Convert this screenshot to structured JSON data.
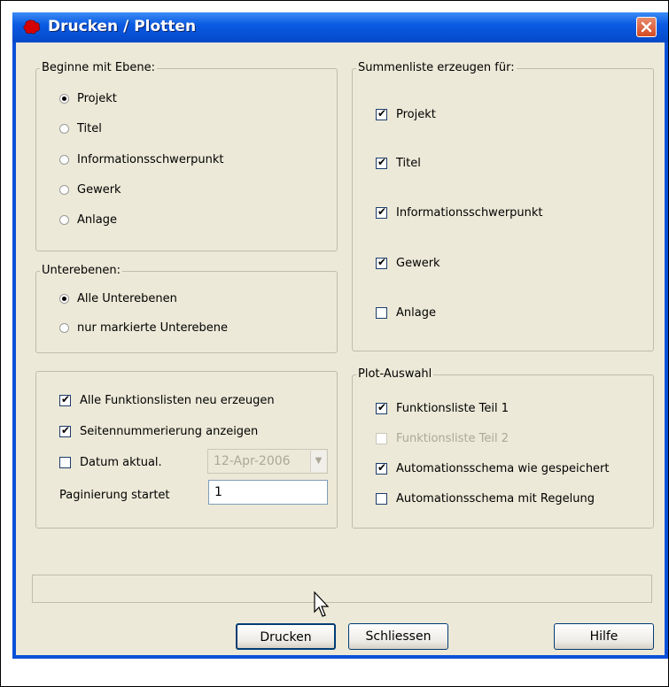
{
  "window": {
    "title": "Drucken / Plotten"
  },
  "ebene": {
    "label": "Beginne mit Ebene:",
    "options": [
      "Projekt",
      "Titel",
      "Informationsschwerpunkt",
      "Gewerk",
      "Anlage"
    ],
    "selected": "Projekt"
  },
  "unterebenen": {
    "label": "Unterebenen:",
    "options": [
      "Alle Unterebenen",
      "nur markierte Unterebene"
    ],
    "selected": "Alle Unterebenen"
  },
  "summenliste": {
    "label": "Summenliste erzeugen für:",
    "items": [
      {
        "label": "Projekt",
        "checked": true
      },
      {
        "label": "Titel",
        "checked": true
      },
      {
        "label": "Informationsschwerpunkt",
        "checked": true
      },
      {
        "label": "Gewerk",
        "checked": true
      },
      {
        "label": "Anlage",
        "checked": false
      }
    ]
  },
  "optionen": {
    "neu_erzeugen": "Alle Funktionslisten neu erzeugen",
    "seitennummerierung": "Seitennummerierung anzeigen",
    "datum_label": "Datum aktual.",
    "datum_value": "12-Apr-2006",
    "paginierung_label": "Paginierung startet",
    "paginierung_value": "1"
  },
  "plot": {
    "label": "Plot-Auswahl",
    "items": [
      {
        "label": "Funktionsliste Teil 1",
        "checked": true,
        "enabled": true
      },
      {
        "label": "Funktionsliste Teil 2",
        "checked": false,
        "enabled": false
      },
      {
        "label": "Automationsschema wie gespeichert",
        "checked": true,
        "enabled": true
      },
      {
        "label": "Automationsschema mit Regelung",
        "checked": false,
        "enabled": true
      }
    ]
  },
  "buttons": {
    "drucken": "Drucken",
    "schliessen": "Schliessen",
    "hilfe": "Hilfe"
  }
}
